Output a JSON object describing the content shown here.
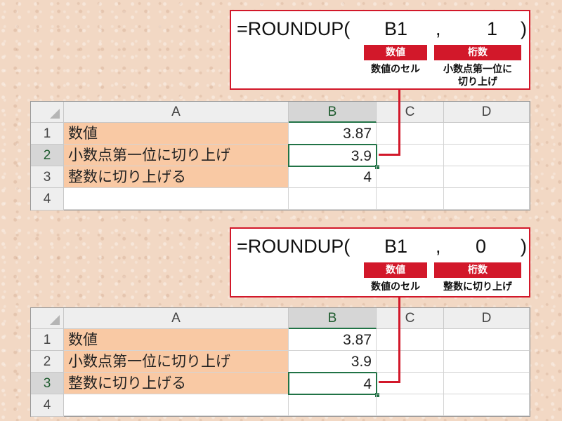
{
  "panels": [
    {
      "formula": {
        "func": "=ROUNDUP(",
        "arg1": "B1",
        "comma": ",",
        "arg2": "1",
        "close": ")"
      },
      "tags": {
        "arg1": "数値",
        "arg2": "桁数"
      },
      "desc": {
        "arg1": "数値のセル",
        "arg2_line1": "小数点第一位に",
        "arg2_line2": "切り上げ"
      },
      "columns": [
        "A",
        "B",
        "C",
        "D"
      ],
      "rows": [
        {
          "num": "1",
          "a": "数値",
          "b": "3.87"
        },
        {
          "num": "2",
          "a": "小数点第一位に切り上げ",
          "b": "3.9"
        },
        {
          "num": "3",
          "a": "整数に切り上げる",
          "b": "4"
        },
        {
          "num": "4",
          "a": "",
          "b": ""
        }
      ]
    },
    {
      "formula": {
        "func": "=ROUNDUP(",
        "arg1": "B1",
        "comma": ",",
        "arg2": "0",
        "close": ")"
      },
      "tags": {
        "arg1": "数値",
        "arg2": "桁数"
      },
      "desc": {
        "arg1": "数値のセル",
        "arg2_line1": "整数に切り上げ",
        "arg2_line2": ""
      },
      "columns": [
        "A",
        "B",
        "C",
        "D"
      ],
      "rows": [
        {
          "num": "1",
          "a": "数値",
          "b": "3.87"
        },
        {
          "num": "2",
          "a": "小数点第一位に切り上げ",
          "b": "3.9"
        },
        {
          "num": "3",
          "a": "整数に切り上げる",
          "b": "4"
        },
        {
          "num": "4",
          "a": "",
          "b": ""
        }
      ]
    }
  ],
  "colors": {
    "accent": "#d2182a",
    "excel_green": "#217346",
    "label_fill": "#f9c9a4"
  }
}
